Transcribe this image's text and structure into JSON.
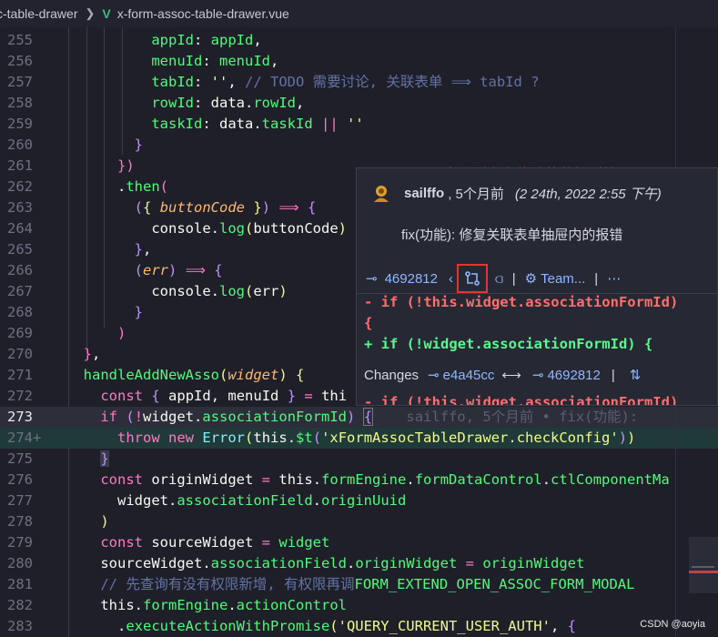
{
  "breadcrumb": {
    "parent": "c-table-drawer",
    "file": "x-form-assoc-table-drawer.vue"
  },
  "annotation": "可以查看到上次修改的数据对比",
  "blame_inline": "sailffo, 5个月前 • fix(功能):",
  "popup": {
    "author": "sailffo",
    "when": ", 5个月前",
    "date": "(2 24th, 2022 2:55 下午)",
    "message": "fix(功能): 修复关联表单抽屉内的报错",
    "commit": "4692812",
    "team": "Team...",
    "diff_minus_1": "- if (!this.widget.associationFormId)",
    "diff_minus_2": "{",
    "diff_plus": "+ if (!widget.associationFormId) {",
    "changes_label": "Changes",
    "from_hash": "e4a45cc",
    "to_hash": "4692812",
    "arrow": "⟷",
    "diff_minus_tail": "- if (!this.widget.associationFormId)"
  },
  "line_numbers": [
    "255",
    "256",
    "257",
    "258",
    "259",
    "260",
    "261",
    "262",
    "263",
    "264",
    "265",
    "266",
    "267",
    "268",
    "269",
    "270",
    "271",
    "272",
    "273",
    "274",
    "275",
    "276",
    "277",
    "278",
    "279",
    "280",
    "281",
    "282",
    "283"
  ],
  "watermark": "CSDN @aoyia",
  "colors": {
    "bg": "#1e1f29",
    "keyword": "#ff79c6",
    "function": "#50fa7b",
    "string": "#f1fa8c",
    "comment": "#6272a4",
    "param": "#ffb86c",
    "annotation": "#ff3030"
  }
}
